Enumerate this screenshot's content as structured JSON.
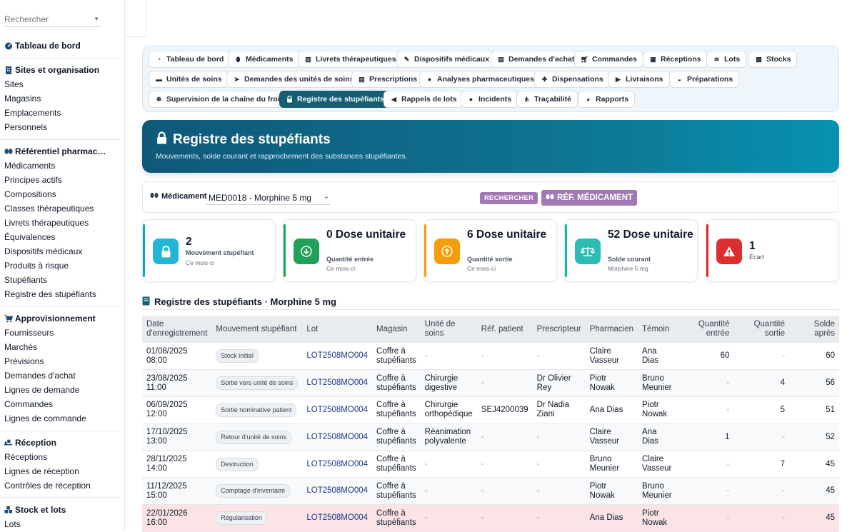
{
  "sidebar": {
    "search_placeholder": "Rechercher",
    "dashboard": "Tableau de bord",
    "sections": [
      {
        "title": "Sites et organisation",
        "items": [
          "Sites",
          "Magasins",
          "Emplacements",
          "Personnels"
        ]
      },
      {
        "title": "Référentiel pharmac…",
        "items": [
          "Médicaments",
          "Principes actifs",
          "Compositions",
          "Classes thérapeutiques",
          "Livrets thérapeutiques",
          "Équivalences",
          "Dispositifs médicaux",
          "Produits à risque",
          "Stupéfiants",
          "Registre des stupéfiants"
        ]
      },
      {
        "title": "Approvisionnement",
        "items": [
          "Fournisseurs",
          "Marchés",
          "Prévisions",
          "Demandes d'achat",
          "Lignes de demande",
          "Commandes",
          "Lignes de commande"
        ]
      },
      {
        "title": "Réception",
        "items": [
          "Réceptions",
          "Lignes de réception",
          "Contrôles de réception"
        ]
      },
      {
        "title": "Stock et lots",
        "items": [
          "Lots"
        ]
      }
    ]
  },
  "tabs": [
    "Tableau de bord",
    "Médicaments",
    "Livrets thérapeutiques",
    "Dispositifs médicaux",
    "Demandes d'achat",
    "Commandes",
    "Réceptions",
    "Lots",
    "Stocks",
    "Unités de soins",
    "Demandes des unités de soins",
    "Prescriptions",
    "Analyses pharmaceutiques",
    "Dispensations",
    "Livraisons",
    "Préparations",
    "Supervision de la chaîne du froid",
    "Registre des stupéfiants",
    "Rappels de lots",
    "Incidents",
    "Traçabilité",
    "Rapports"
  ],
  "active_tab": "Registre des stupéfiants",
  "hero": {
    "title": "Registre des stupéfiants",
    "subtitle": "Mouvements, solde courant et rapprochement des substances stupéfiantes."
  },
  "filter": {
    "label": "Médicament",
    "selected": "MED0018 - Morphine 5 mg",
    "search_button": "RECHERCHER",
    "ref_button": "RÉF. MÉDICAMENT"
  },
  "kpis": [
    {
      "value": "2",
      "label": "Mouvement stupéfiant",
      "sub": "Ce mois-ci",
      "color": "#0ea5c6",
      "icon": "lock-icon"
    },
    {
      "value": "0 Dose unitaire",
      "label": "Quantité entrée",
      "sub": "Ce mois-ci",
      "color": "#16a34a",
      "icon": "arrow-down-icon"
    },
    {
      "value": "6 Dose unitaire",
      "label": "Quantité sortie",
      "sub": "Ce mois-ci",
      "color": "#f59e0b",
      "icon": "arrow-up-icon"
    },
    {
      "value": "52 Dose unitaire",
      "label": "Solde courant",
      "sub": "Morphine 5 mg",
      "color": "#14b8a6",
      "icon": "scale-icon"
    },
    {
      "value": "1",
      "label": "Écart",
      "sub": "",
      "color": "#dc2626",
      "icon": "warning-icon"
    }
  ],
  "table": {
    "title": "Registre des stupéfiants · Morphine 5 mg",
    "columns": [
      "Date d'enregistrement",
      "Mouvement stupéfiant",
      "Lot",
      "Magasin",
      "Unité de soins",
      "Réf. patient",
      "Prescripteur",
      "Pharmacien",
      "Témoin",
      "Quantité entrée",
      "Quantité sortie",
      "Solde après"
    ],
    "rows": [
      [
        "01/08/2025 08:00",
        "Stock initial",
        "LOT2508MO004",
        "Coffre à stupéfiants",
        "-",
        "-",
        "-",
        "Claire Vasseur",
        "Ana Dias",
        "60",
        "-",
        "60"
      ],
      [
        "23/08/2025 11:00",
        "Sortie vers unité de soins",
        "LOT2508MO004",
        "Coffre à stupéfiants",
        "Chirurgie digestive",
        "-",
        "Dr Olivier Rey",
        "Piotr Nowak",
        "Bruno Meunier",
        "-",
        "4",
        "56"
      ],
      [
        "06/09/2025 12:00",
        "Sortie nominative patient",
        "LOT2508MO004",
        "Coffre à stupéfiants",
        "Chirurgie orthopédique",
        "SEJ4200039",
        "Dr Nadia Ziani",
        "Ana Dias",
        "Piotr Nowak",
        "-",
        "5",
        "51"
      ],
      [
        "17/10/2025 13:00",
        "Retour d'unité de soins",
        "LOT2508MO004",
        "Coffre à stupéfiants",
        "Réanimation polyvalente",
        "-",
        "-",
        "Claire Vasseur",
        "Ana Dias",
        "1",
        "-",
        "52"
      ],
      [
        "28/11/2025 14:00",
        "Destruction",
        "LOT2508MO004",
        "Coffre à stupéfiants",
        "-",
        "-",
        "-",
        "Bruno Meunier",
        "Claire Vasseur",
        "-",
        "7",
        "45"
      ],
      [
        "11/12/2025 15:00",
        "Comptage d'inventaire",
        "LOT2508MO004",
        "Coffre à stupéfiants",
        "-",
        "-",
        "-",
        "Piotr Nowak",
        "Bruno Meunier",
        "-",
        "-",
        "45"
      ],
      [
        "22/01/2026 16:00",
        "Régularisation",
        "LOT2508MO004",
        "Coffre à stupéfiants",
        "-",
        "-",
        "-",
        "Ana Dias",
        "Piotr Nowak",
        "-",
        "-",
        "45"
      ]
    ]
  }
}
